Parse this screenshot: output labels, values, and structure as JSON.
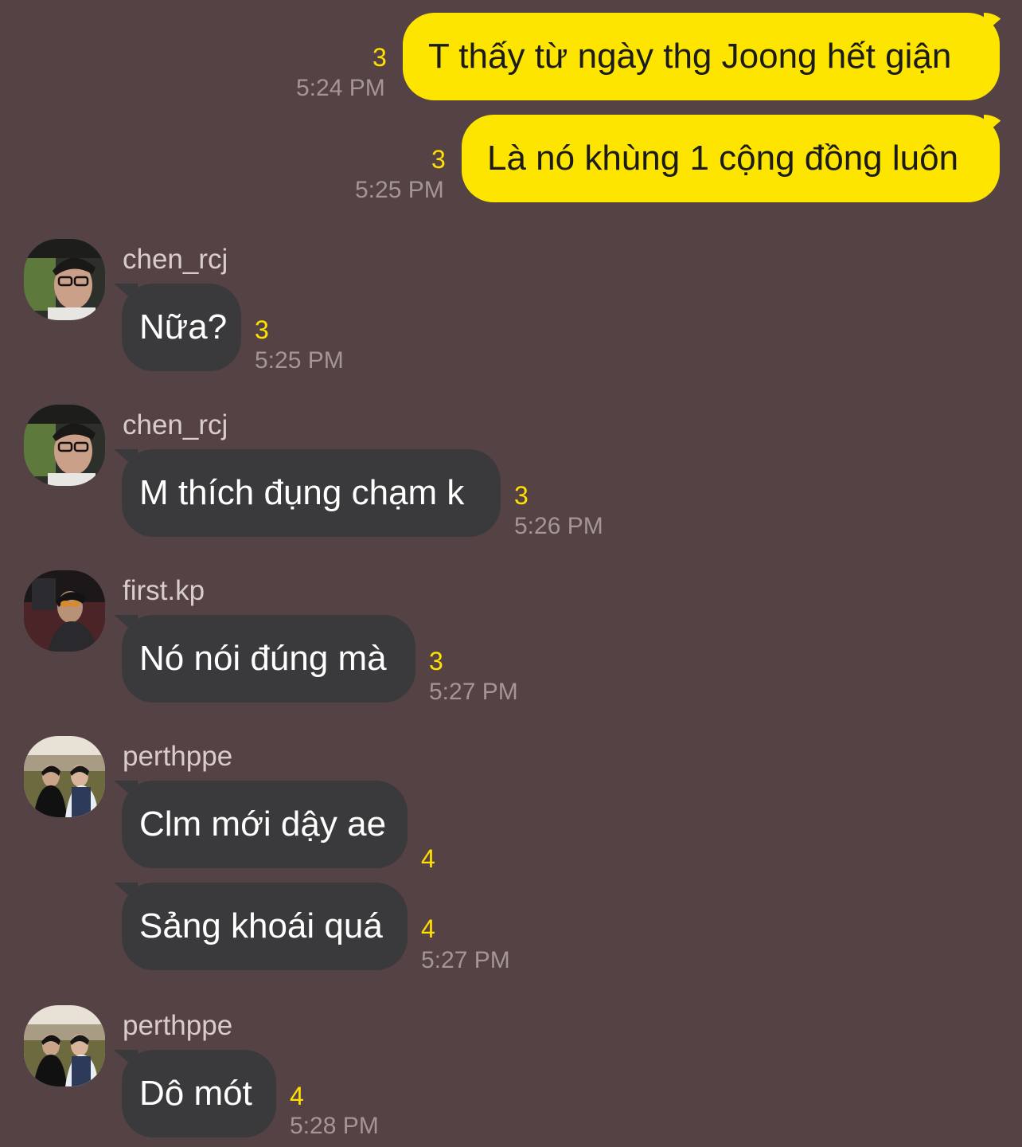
{
  "colors": {
    "background": "#554244",
    "outgoing_bubble": "#FEE500",
    "incoming_bubble": "#3a3a3c",
    "unread_count": "#FFE000"
  },
  "messages": [
    {
      "direction": "outgoing",
      "text": "T thấy từ ngày thg Joong hết giận",
      "unread": "3",
      "time": "5:24 PM"
    },
    {
      "direction": "outgoing",
      "text": "Là nó khùng 1 cộng đồng luôn",
      "unread": "3",
      "time": "5:25 PM"
    },
    {
      "direction": "incoming",
      "sender": "chen_rcj",
      "avatar": "avatar-chen-icon",
      "text": "Nữa?",
      "unread": "3",
      "time": "5:25 PM"
    },
    {
      "direction": "incoming",
      "sender": "chen_rcj",
      "avatar": "avatar-chen-icon",
      "text": "M thích đụng chạm k",
      "unread": "3",
      "time": "5:26 PM"
    },
    {
      "direction": "incoming",
      "sender": "first.kp",
      "avatar": "avatar-first-icon",
      "text": "Nó nói đúng mà",
      "unread": "3",
      "time": "5:27 PM"
    },
    {
      "direction": "incoming",
      "sender": "perthppe",
      "avatar": "avatar-perth-icon",
      "text": "Clm mới dậy ae",
      "unread": "4"
    },
    {
      "direction": "incoming",
      "text": "Sảng khoái quá",
      "unread": "4",
      "time": "5:27 PM"
    },
    {
      "direction": "incoming",
      "sender": "perthppe",
      "avatar": "avatar-perth-icon",
      "text": "Dô mót",
      "unread": "4",
      "time": "5:28 PM"
    }
  ]
}
